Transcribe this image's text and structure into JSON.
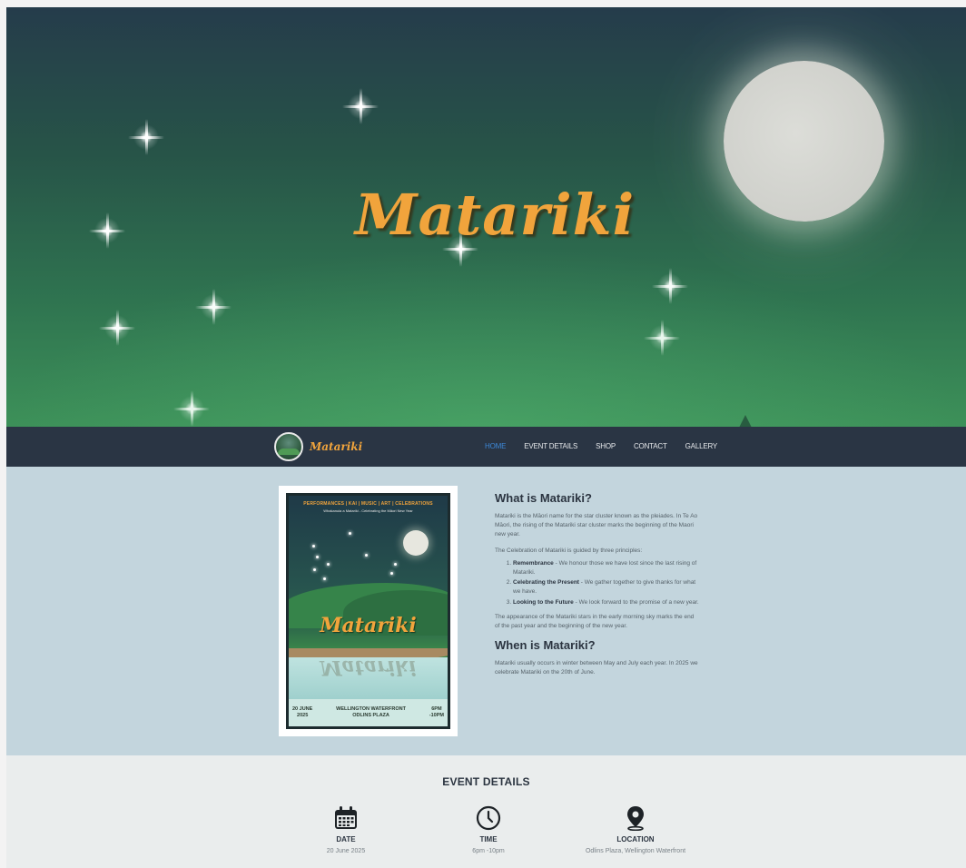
{
  "hero": {
    "title": "Matariki"
  },
  "nav": {
    "logo_text": "Matariki",
    "links": [
      {
        "label": "HOME",
        "active": true
      },
      {
        "label": "EVENT DETAILS",
        "active": false
      },
      {
        "label": "SHOP",
        "active": false
      },
      {
        "label": "CONTACT",
        "active": false
      },
      {
        "label": "GALLERY",
        "active": false
      }
    ]
  },
  "poster": {
    "top_line": "PERFORMANCES  |  KAI  |  MUSIC  |  ART  |  CELEBRATIONS",
    "subtitle": "Whakanuia a Matariki - Celebrating the Māori New Year",
    "title": "Matariki",
    "date_line1": "20 JUNE",
    "date_line2": "2025",
    "venue_line1": "WELLINGTON WATERFRONT",
    "venue_line2": "ODLINS PLAZA",
    "time_line1": "6PM",
    "time_line2": "-10PM"
  },
  "about": {
    "heading": "What is Matariki?",
    "intro": "Matariki is the Māori name for the star cluster known as the pleiades. In Te Ao Māori, the rising of the Matariki star cluster marks the beginning of the Maori new year.",
    "principles_intro": "The Celebration of Matariki is guided by three principles:",
    "principles": [
      {
        "title": "Remembrance",
        "text": " - We honour those we have lost since the last rising of Matariki."
      },
      {
        "title": "Celebrating the Present",
        "text": " - We gather together to give thanks for what we have."
      },
      {
        "title": "Looking to the Future",
        "text": " - We look forward to the promise of a new year."
      }
    ],
    "appearance": "The appearance of the Matariki stars in the early morning sky marks the end of the past year and the beginning of the new year.",
    "when_heading": "When is Matariki?",
    "when_text": "Matariki usually occurs in winter between May and July each year. In 2025 we celebrate Matariki on the 20th of June."
  },
  "event_details": {
    "title": "EVENT DETAILS",
    "items": [
      {
        "label": "DATE",
        "value": "20 June 2025",
        "icon": "calendar-icon"
      },
      {
        "label": "TIME",
        "value": "6pm -10pm",
        "icon": "clock-icon"
      },
      {
        "label": "LOCATION",
        "value": "Odlins Plaza, Wellington Waterfront",
        "icon": "location-pin-icon"
      }
    ]
  },
  "colors": {
    "accent": "#f1a43c",
    "nav_bg": "#2a3544",
    "nav_active": "#3c87d6",
    "info_bg": "#c3d5dd",
    "details_bg": "#eaeded"
  }
}
